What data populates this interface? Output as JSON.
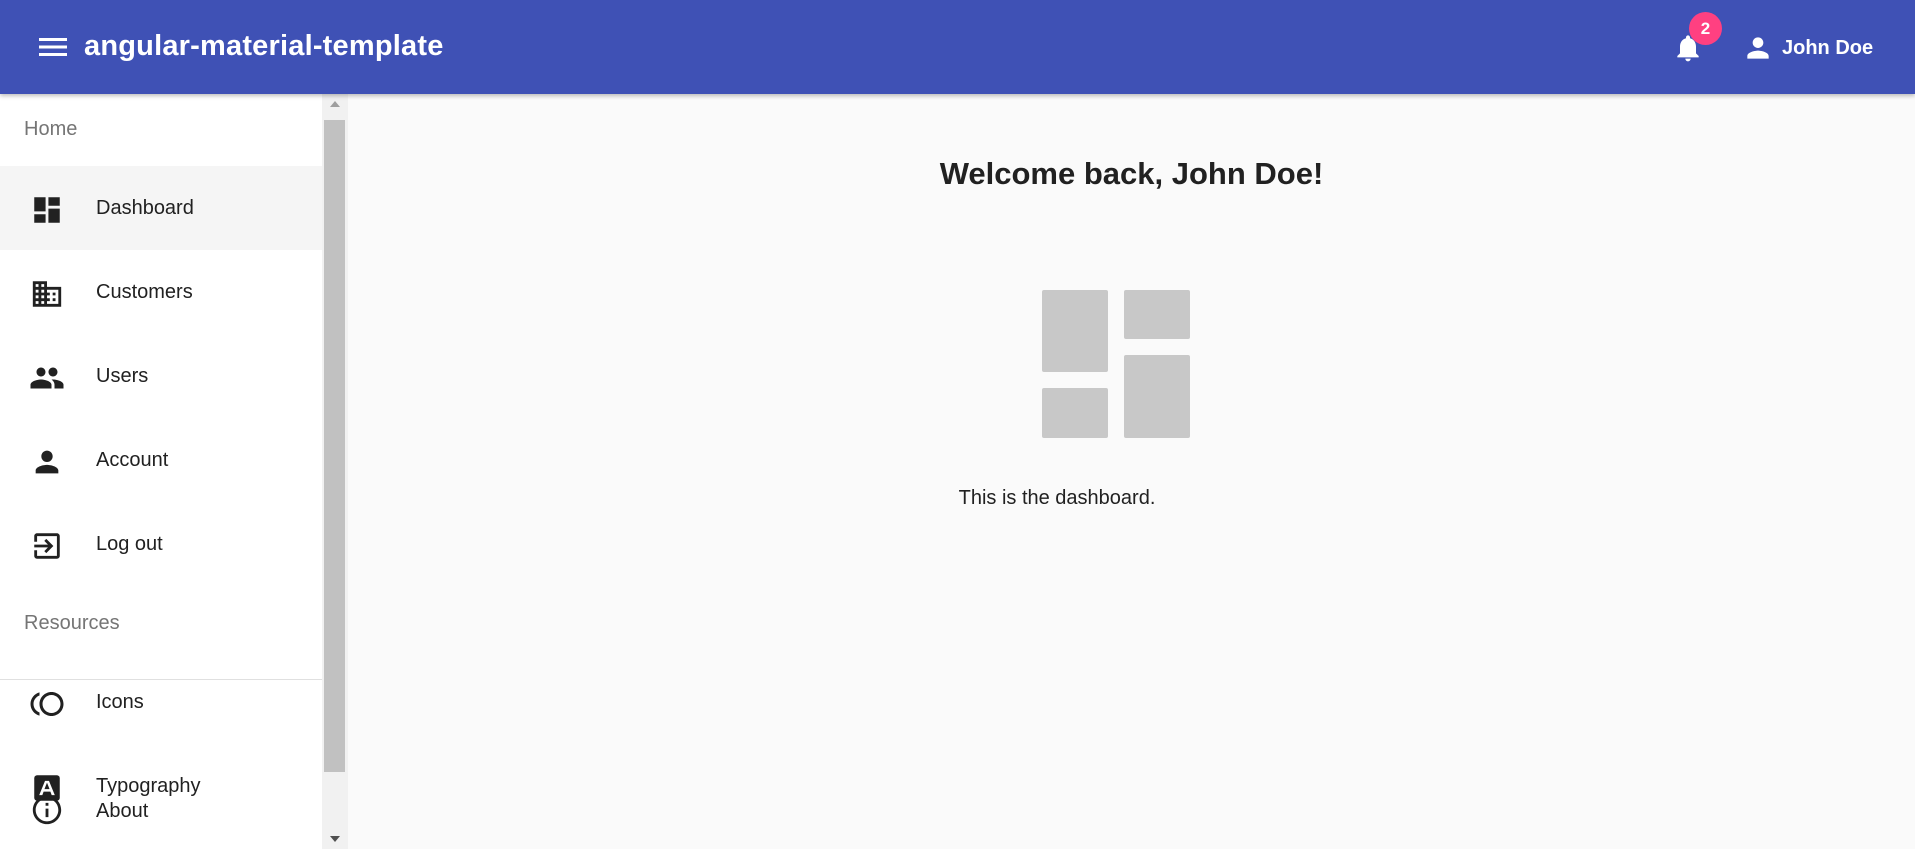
{
  "header": {
    "app_title": "angular-material-template",
    "notification_count": "2",
    "user_name": "John Doe"
  },
  "sidebar": {
    "sections": [
      {
        "label": "Home",
        "items": [
          {
            "label": "Dashboard",
            "icon": "dashboard-icon",
            "active": true
          },
          {
            "label": "Customers",
            "icon": "business-icon",
            "active": false
          },
          {
            "label": "Users",
            "icon": "people-icon",
            "active": false
          },
          {
            "label": "Account",
            "icon": "person-icon",
            "active": false
          },
          {
            "label": "Log out",
            "icon": "logout-icon",
            "active": false
          }
        ]
      },
      {
        "label": "Resources",
        "items": [
          {
            "label": "Icons",
            "icon": "toll-icon"
          },
          {
            "label": "Typography",
            "icon": "font-icon"
          },
          {
            "label": "About",
            "icon": "info-icon"
          }
        ]
      }
    ]
  },
  "main": {
    "welcome": "Welcome back, John Doe!",
    "description": "This is the dashboard."
  },
  "colors": {
    "primary": "#3f51b5",
    "accent": "#ff4081",
    "background": "#fafafa"
  }
}
